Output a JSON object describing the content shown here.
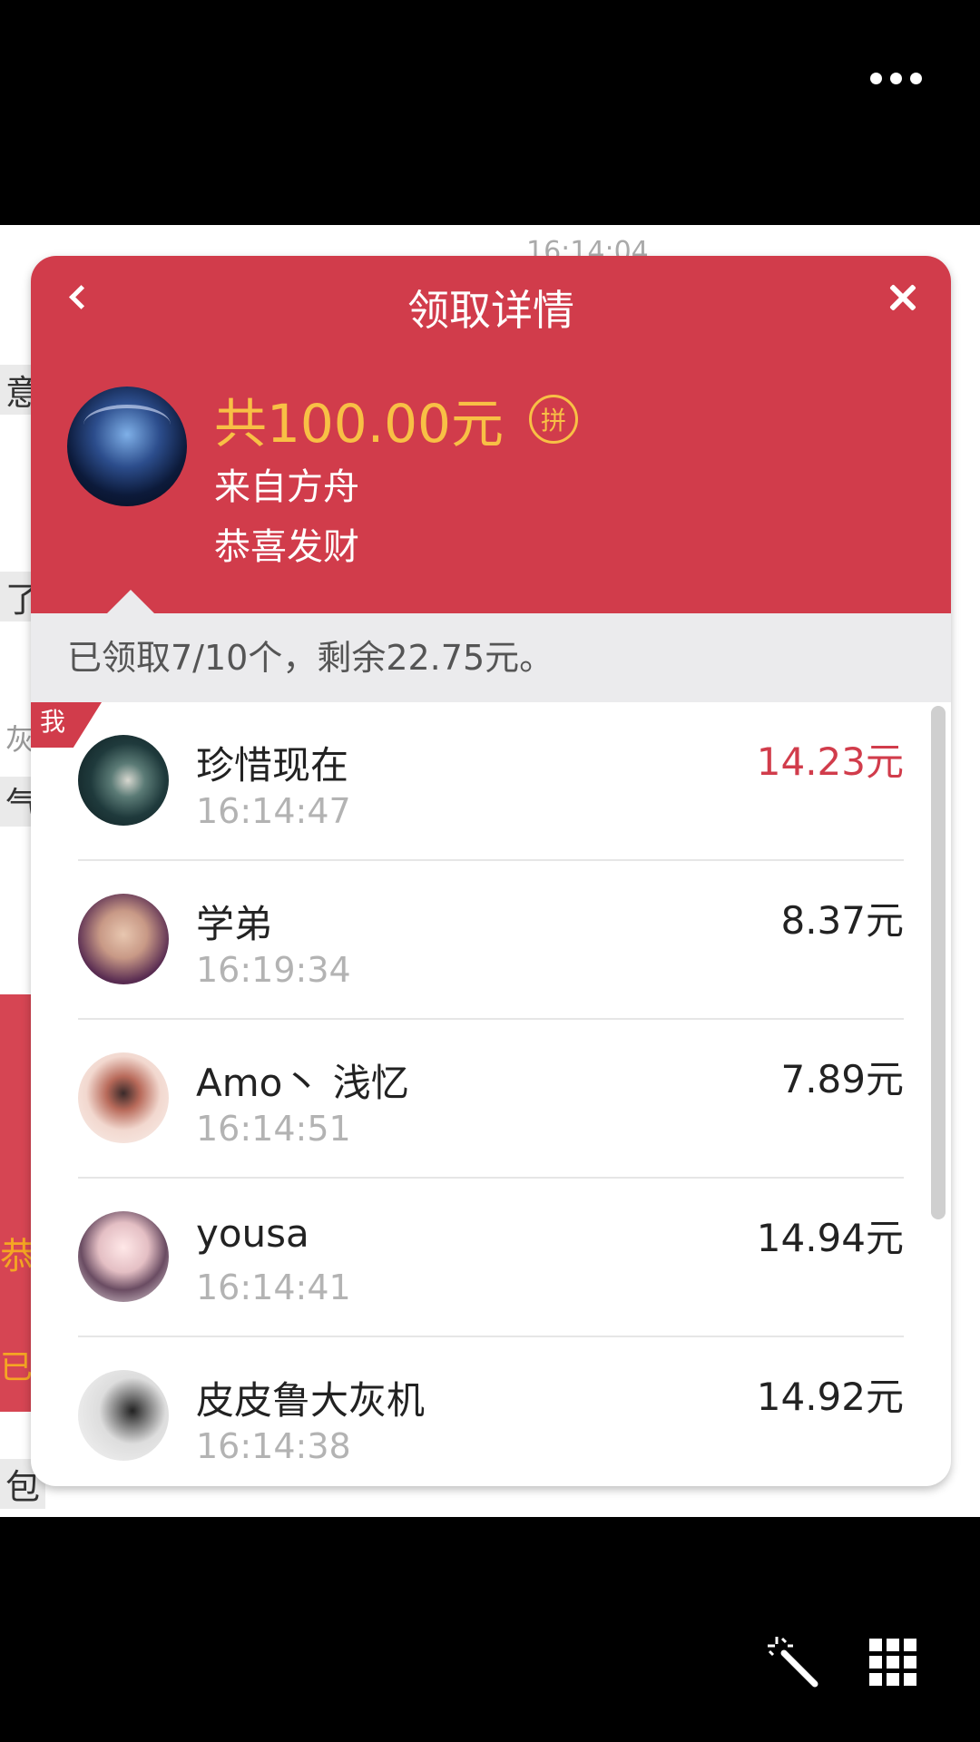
{
  "chat_background": {
    "time": "16:14:04",
    "snippets": [
      "意思",
      "了",
      "灰",
      "气",
      "恭喜",
      "已",
      "包"
    ]
  },
  "card": {
    "title": "领取详情",
    "total": "共100.00元",
    "badge": "拼",
    "from": "来自方舟",
    "blessing": "恭喜发财",
    "summary": "已领取7/10个，剩余22.75元。",
    "me_tag": "我",
    "receivers": [
      {
        "name": "珍惜现在",
        "time": "16:14:47",
        "amount": "14.23元",
        "best": true
      },
      {
        "name": "学弟",
        "time": "16:19:34",
        "amount": "8.37元"
      },
      {
        "name": "Amo丶 浅忆",
        "time": "16:14:51",
        "amount": "7.89元"
      },
      {
        "name": "yousa",
        "time": "16:14:41",
        "amount": "14.94元"
      },
      {
        "name": "皮皮鲁大灰机",
        "time": "16:14:38",
        "amount": "14.92元"
      }
    ]
  },
  "colors": {
    "header_red": "#d13c4b",
    "gold": "#f8c045",
    "best_amount": "#d13c4b"
  }
}
